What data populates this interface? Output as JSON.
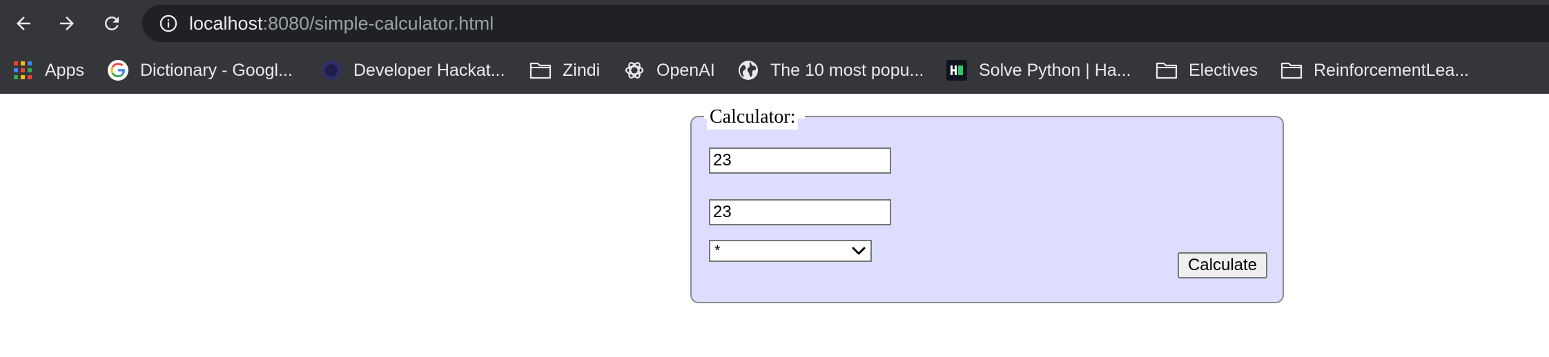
{
  "browser": {
    "url_host": "localhost",
    "url_rest": ":8080/simple-calculator.html",
    "icons": {
      "back": "arrow-left-icon",
      "forward": "arrow-right-icon",
      "reload": "reload-icon",
      "info": "info-icon"
    }
  },
  "bookmarks": [
    {
      "label": "Apps",
      "icon": "apps-grid-icon"
    },
    {
      "label": "Dictionary - Googl...",
      "icon": "google-icon"
    },
    {
      "label": "Developer Hackat...",
      "icon": "site-favicon-icon"
    },
    {
      "label": "Zindi",
      "icon": "folder-icon"
    },
    {
      "label": "OpenAI",
      "icon": "openai-icon"
    },
    {
      "label": "The 10 most popu...",
      "icon": "globe-icon"
    },
    {
      "label": "Solve Python | Ha...",
      "icon": "hackerrank-icon"
    },
    {
      "label": "Electives",
      "icon": "folder-icon"
    },
    {
      "label": "ReinforcementLea...",
      "icon": "folder-icon"
    }
  ],
  "calculator": {
    "legend": "Calculator:",
    "first_number": "23",
    "second_number": "23",
    "operator": "*",
    "calculate_label": "Calculate",
    "background_color": "#ddddff"
  }
}
